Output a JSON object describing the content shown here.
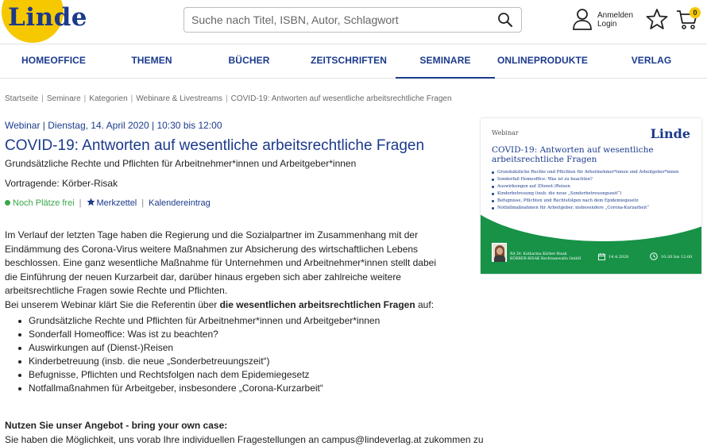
{
  "header": {
    "logo": "Linde",
    "search_placeholder": "Suche nach Titel, ISBN, Autor, Schlagwort",
    "login_line1": "Anmelden",
    "login_line2": "Login",
    "cart_count": "0"
  },
  "nav": {
    "items": [
      "HOMEOFFICE",
      "THEMEN",
      "BÜCHER",
      "ZEITSCHRIFTEN",
      "SEMINARE",
      "ONLINEPRODUKTE",
      "VERLAG"
    ],
    "active": "SEMINARE"
  },
  "breadcrumb": [
    "Startseite",
    "Seminare",
    "Kategorien",
    "Webinare & Livestreams",
    "COVID-19: Antworten auf wesentliche arbeitsrechtliche Fragen"
  ],
  "event": {
    "meta": "Webinar | Dienstag, 14. April 2020 | 10:30 bis 12:00",
    "title": "COVID-19: Antworten auf wesentliche arbeitsrechtliche Fragen",
    "subtitle": "Grundsätzliche Rechte und Pflichten für Arbeitnehmer*innen und Arbeitgeber*innen",
    "speaker": "Vortragende: Körber-Risak",
    "status": "Noch Plätze frei",
    "watchlist": "Merkzettel",
    "calendar": "Kalendereintrag"
  },
  "content": {
    "paragraph": "Im Verlauf der letzten Tage haben die Regierung und die Sozialpartner im Zusammenhang mit der Eindämmung des Corona-Virus weitere Maßnahmen zur Absicherung des wirtschaftlichen Lebens beschlossen. Eine ganz wesentliche Maßnahme für Unternehmen und Arbeitnehmer*innen stellt dabei die Einführung der neuen Kurzarbeit dar, darüber hinaus ergeben sich aber zahlreiche weitere arbeitsrechtliche Fragen sowie Rechte und Pflichten.",
    "intro_before": "Bei unserem Webinar klärt Sie die Referentin über ",
    "intro_bold": "die wesentlichen arbeitsrechtlichen Fragen",
    "intro_after": " auf:",
    "bullets": [
      "Grundsätzliche Rechte und Pflichten für Arbeitnehmer*innen und Arbeitgeber*innen",
      "Sonderfall Homeoffice: Was ist zu beachten?",
      "Auswirkungen auf (Dienst-)Reisen",
      "Kinderbetreuung (insb. die neue „Sonderbetreuungszeit“)",
      "Befugnisse, Pflichten und Rechtsfolgen nach dem Epidemiegesetz",
      "Notfallmaßnahmen für Arbeitgeber, insbesondere „Corona-Kurzarbeit“"
    ],
    "offer_title": "Nutzen Sie unser Angebot - bring your own case:",
    "offer_text": "Sie haben die Möglichkeit, uns vorab Ihre individuellen Fragestellungen an campus@lindeverlag.at zukommen zu"
  },
  "card": {
    "label": "Webinar",
    "logo": "Linde",
    "title": "COVID-19: Antworten auf wesentliche arbeitsrechtliche Fragen",
    "bullets": [
      "Grundsätzliche Rechte und Pflichten für Arbeitnehmer*innen und Arbeitgeber*innen",
      "Sonderfall Homeoffice: Was ist zu beachten?",
      "Auswirkungen auf (Dienst-)Reisen",
      "Kinderbetreuung (insb. die neue „Sonderbetreuungszeit“)",
      "Befugnisse, Pflichten und Rechtsfolgen nach dem Epidemiegesetz",
      "Notfallmaßnahmen für Arbeitgeber, insbesondere „Corona-Kurzarbeit“"
    ],
    "speaker_line1": "RA Dr. Katharina Körber-Risak",
    "speaker_line2": "KÖRBER-RISAK Rechtsanwalts GmbH",
    "date": "14.4.2020",
    "time": "10:30 bis 12:00"
  },
  "colors": {
    "brand_blue": "#1b3a8c",
    "brand_yellow": "#f6c800",
    "card_green": "#179247",
    "available_green": "#3aa84a"
  },
  "icons": [
    "search-icon",
    "user-icon",
    "star-icon",
    "cart-icon",
    "calendar-icon",
    "clock-icon"
  ]
}
